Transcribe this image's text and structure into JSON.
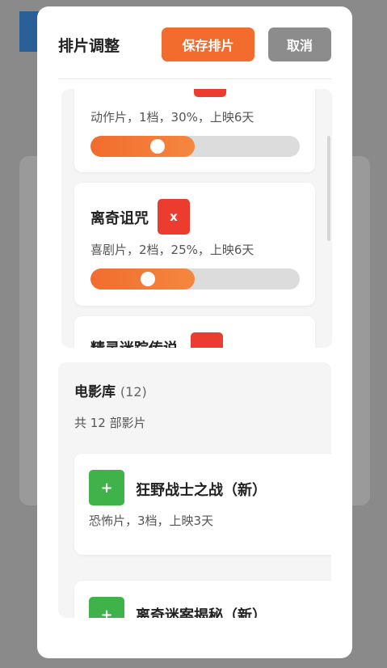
{
  "modal": {
    "title": "排片调整",
    "save_label": "保存排片",
    "cancel_label": "取消"
  },
  "schedule": {
    "items": [
      {
        "title": "",
        "info": "动作片，1档，30%，上映6天",
        "remove_label": "",
        "share_percent": 30
      },
      {
        "title": "离奇诅咒",
        "info": "喜剧片，2档，25%，上映6天",
        "remove_label": "x",
        "share_percent": 25
      },
      {
        "title": "精灵迷踪传说",
        "info": "",
        "remove_label": ""
      }
    ]
  },
  "library": {
    "title": "电影库",
    "count": "(12)",
    "subtitle": "共 12 部影片",
    "items": [
      {
        "name": "狂野战士之战（新）",
        "info": "恐怖片，3档，上映3天",
        "add_label": "+"
      },
      {
        "name": "离奇迷案揭秘（新）",
        "info": "",
        "add_label": "+"
      }
    ]
  },
  "colors": {
    "accent": "#f26c2e",
    "remove": "#ec3c30",
    "add": "#3fb24a",
    "cancel": "#8c8c8c"
  }
}
